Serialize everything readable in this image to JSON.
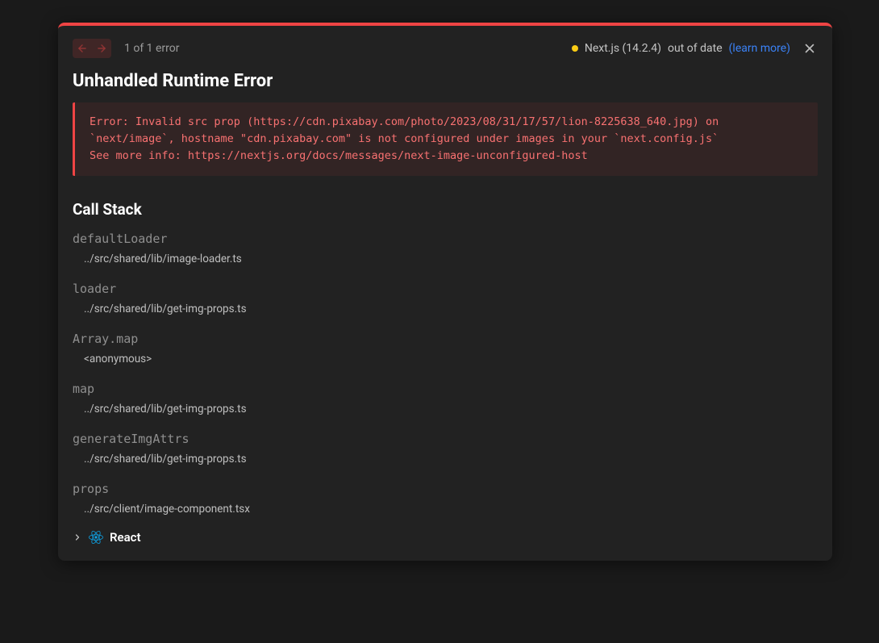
{
  "header": {
    "counter": "1 of 1 error",
    "framework": "Next.js (14.2.4)",
    "status": "out of date",
    "learn_more": "(learn more)"
  },
  "title": "Unhandled Runtime Error",
  "error_message": "Error: Invalid src prop (https://cdn.pixabay.com/photo/2023/08/31/17/57/lion-8225638_640.jpg) on `next/image`, hostname \"cdn.pixabay.com\" is not configured under images in your `next.config.js`\nSee more info: https://nextjs.org/docs/messages/next-image-unconfigured-host",
  "call_stack_title": "Call Stack",
  "frames": [
    {
      "fn": "defaultLoader",
      "loc": "../src/shared/lib/image-loader.ts"
    },
    {
      "fn": "loader",
      "loc": "../src/shared/lib/get-img-props.ts"
    },
    {
      "fn": "Array.map",
      "loc": "<anonymous>"
    },
    {
      "fn": "map",
      "loc": "../src/shared/lib/get-img-props.ts"
    },
    {
      "fn": "generateImgAttrs",
      "loc": "../src/shared/lib/get-img-props.ts"
    },
    {
      "fn": "props",
      "loc": "../src/client/image-component.tsx"
    }
  ],
  "collapsed_section": "React"
}
